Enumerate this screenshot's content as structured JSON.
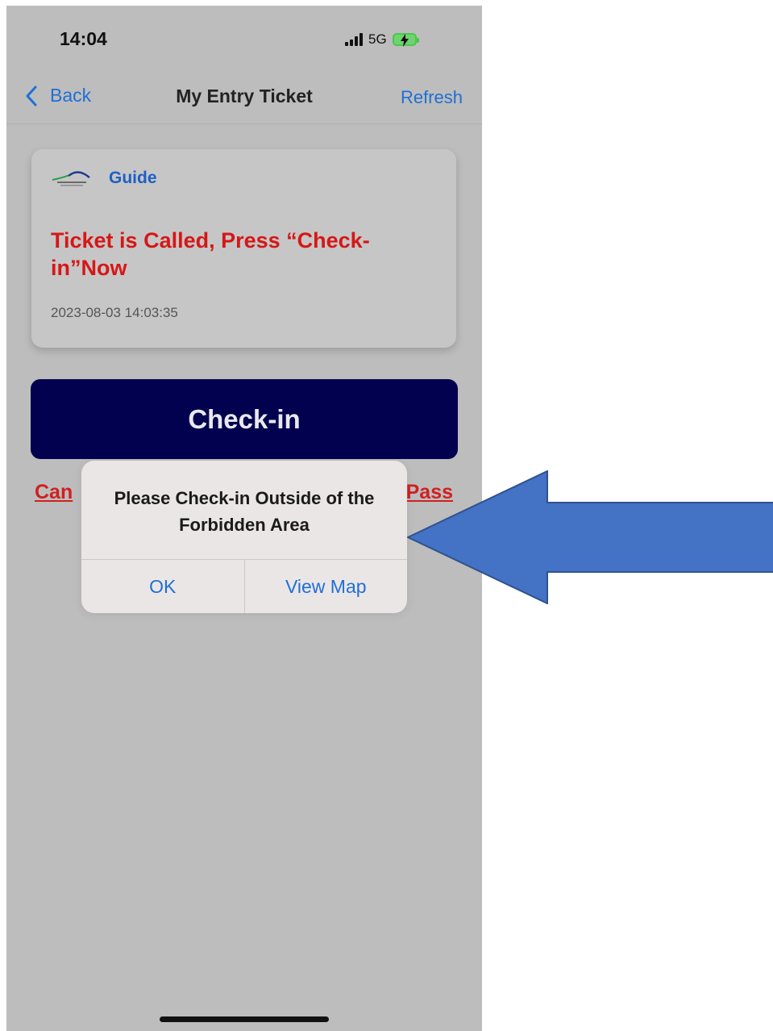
{
  "status_bar": {
    "time": "14:04",
    "network": "5G"
  },
  "nav": {
    "back_label": "Back",
    "title": "My Entry Ticket",
    "refresh_label": "Refresh"
  },
  "ticket": {
    "guide_label": "Guide",
    "message": "Ticket is Called, Press “Check-in”Now",
    "timestamp": "2023-08-03 14:03:35"
  },
  "checkin_button": {
    "label": "Check-in"
  },
  "links": {
    "left_visible": "Can",
    "right_visible": "Pass"
  },
  "alert": {
    "message": "Please Check-in Outside of the Forbidden Area",
    "ok_label": "OK",
    "view_map_label": "View Map"
  },
  "colors": {
    "accent_blue": "#1f6fd6",
    "alert_red": "#d61717",
    "checkin_navy": "#01014f",
    "annotation_arrow": "#4472c4"
  },
  "icons": [
    "chevron-left-icon",
    "signal-icon",
    "battery-charging-icon",
    "guide-logo-icon"
  ]
}
